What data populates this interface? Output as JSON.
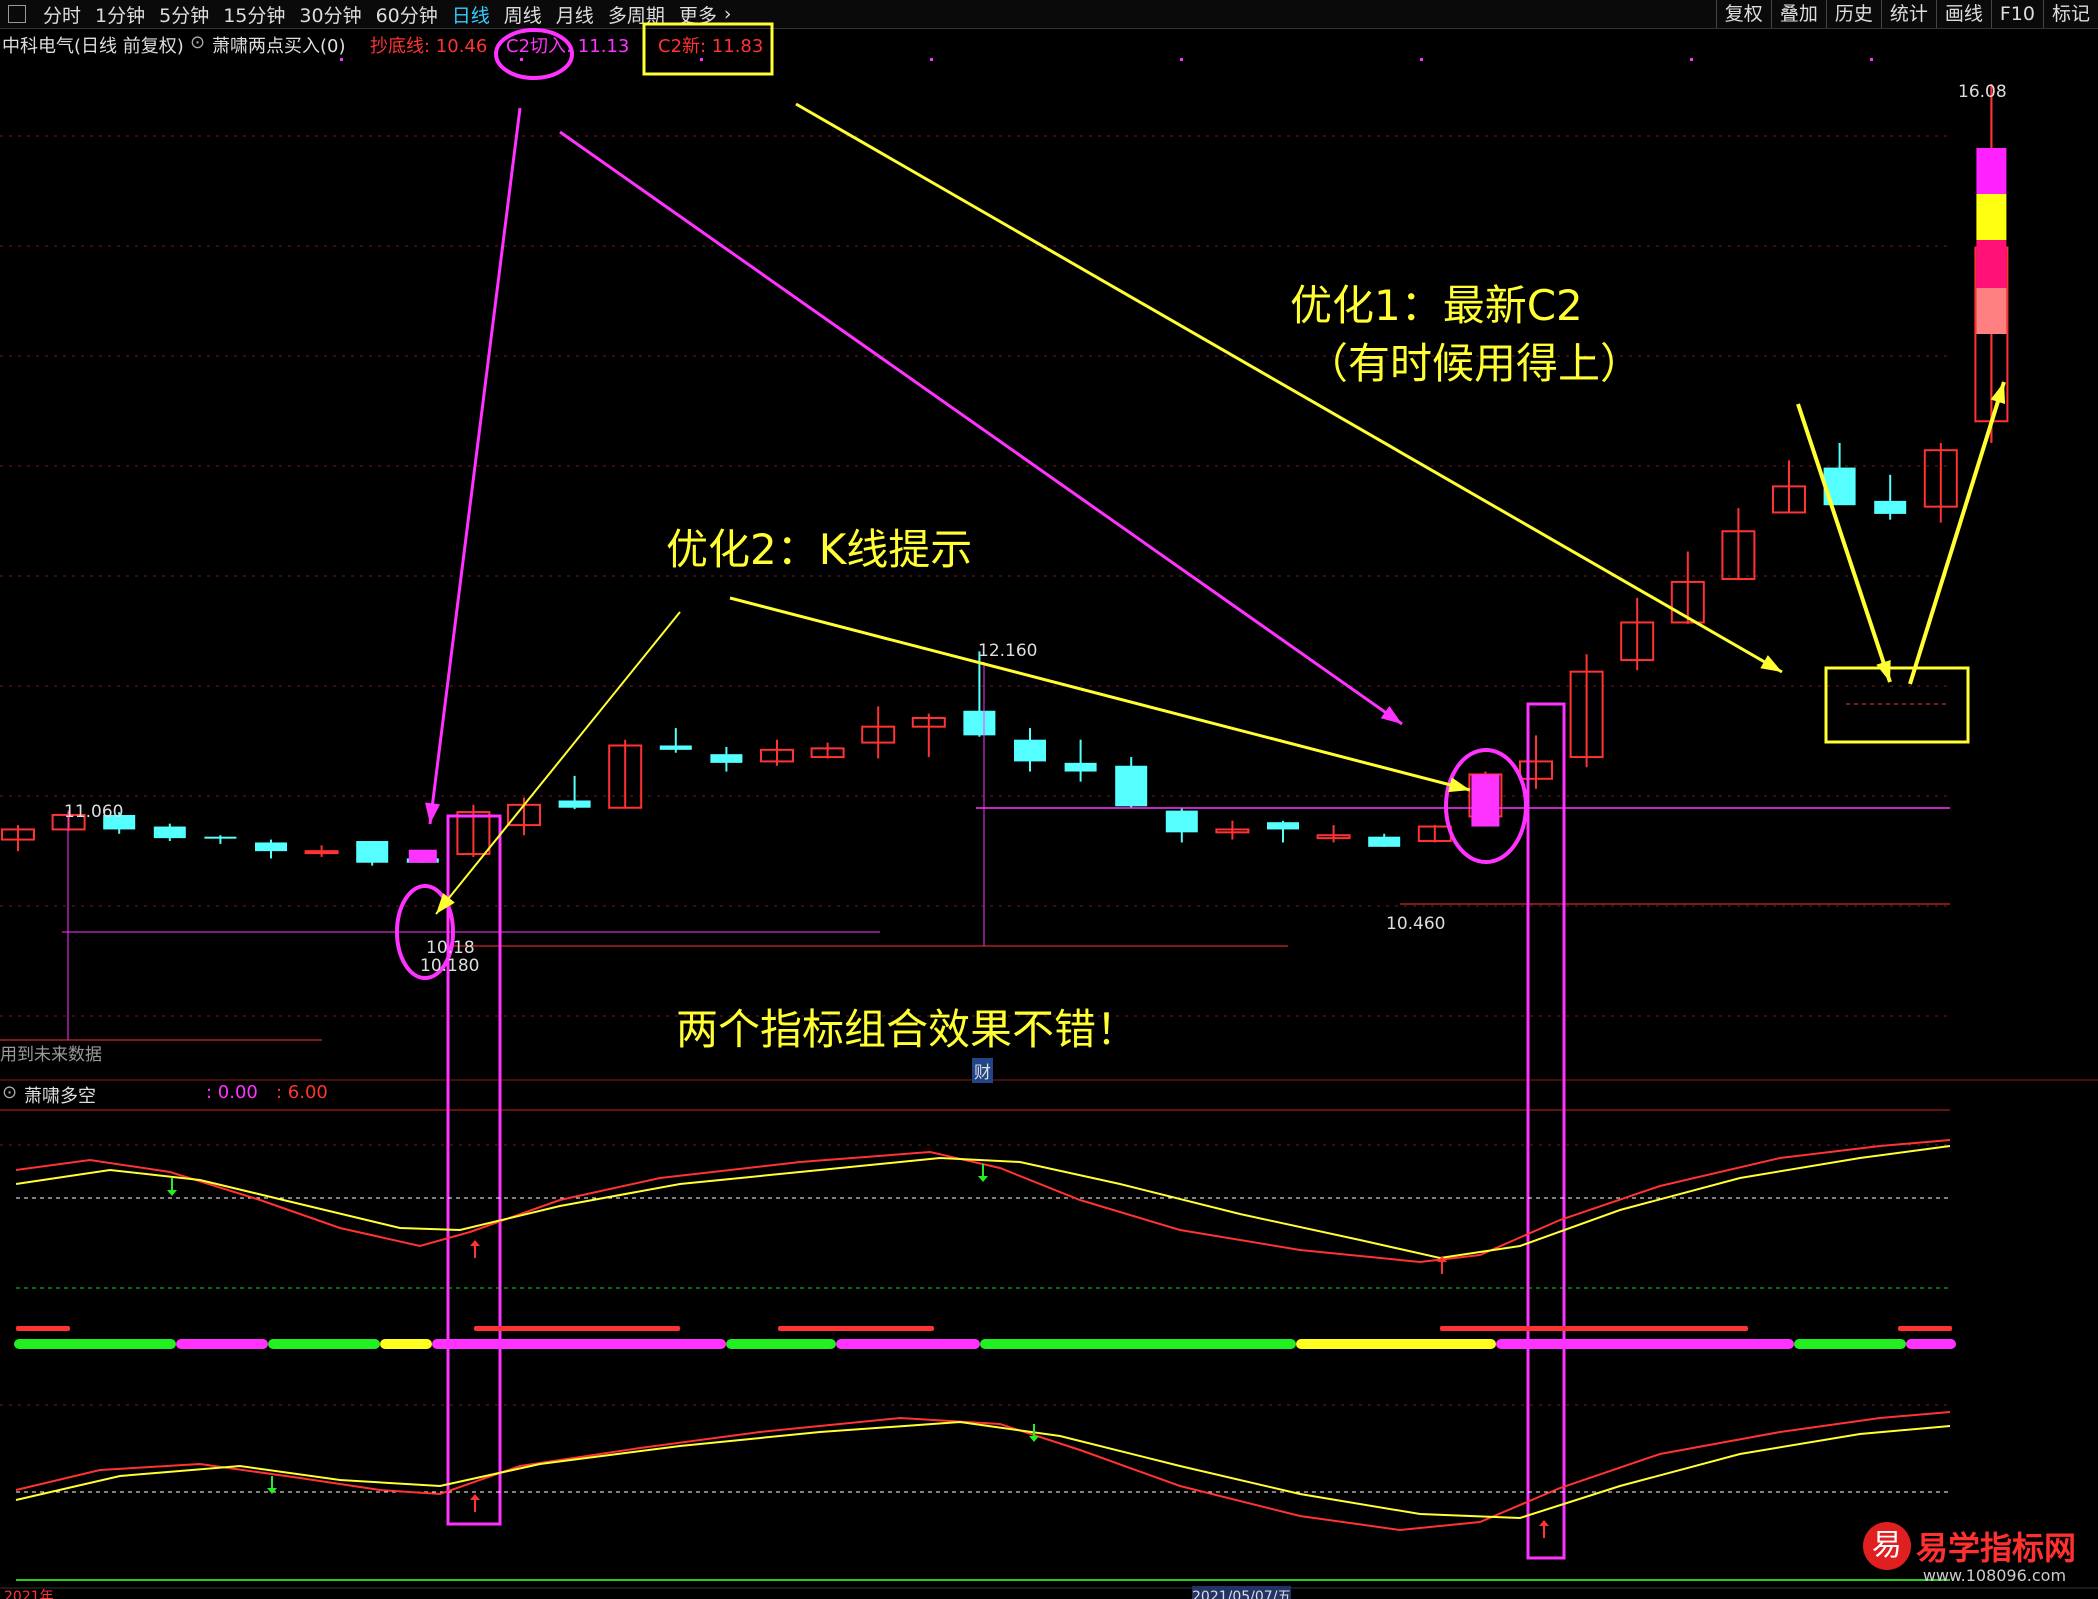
{
  "toolbar": {
    "periods": [
      "分时",
      "1分钟",
      "5分钟",
      "15分钟",
      "30分钟",
      "60分钟",
      "日线",
      "周线",
      "月线",
      "多周期",
      "更多"
    ],
    "active_period": "日线",
    "right_buttons": [
      "复权",
      "叠加",
      "历史",
      "统计",
      "画线",
      "F10",
      "标记"
    ]
  },
  "info": {
    "stock": "中科电气(日线 前复权)",
    "indicator": "萧啸两点买入(0)",
    "line1": "抄底线: 10.46",
    "line2": "C2切入: 11.13",
    "line3": "C2新: 11.83"
  },
  "price_labels": {
    "high_right": "16.08",
    "mid_high": "12.160",
    "left_high": "11.060",
    "low_mid": "10.460",
    "low_left": "10.180",
    "small_left": "10.18"
  },
  "notes": {
    "future_data": "用到未来数据",
    "cai": "财"
  },
  "annotations": {
    "opt1_line1": "优化1：最新C2",
    "opt1_line2": "（有时候用得上）",
    "opt2": "优化2：K线提示",
    "summary": "两个指标组合效果不错！"
  },
  "sub_indicator": {
    "name": "萧啸多空",
    "v1": ": 0.00",
    "v2": ": 6.00"
  },
  "bottom": {
    "date_left": "2021年",
    "date_mid": "2021/05/07/五"
  },
  "watermark": {
    "logo_char": "易",
    "title": "易学指标网",
    "url": "www.108096.com"
  },
  "colors": {
    "up": "#ff3333",
    "down": "#55ffff",
    "magenta": "#ff33ff",
    "yellow": "#ffff33",
    "grid": "#7a1a1a"
  },
  "chart_data": {
    "type": "candlestick",
    "candles": [
      {
        "o": 10.86,
        "h": 10.96,
        "l": 10.78,
        "c": 10.93
      },
      {
        "o": 10.93,
        "h": 11.06,
        "l": 10.92,
        "c": 11.03
      },
      {
        "o": 11.03,
        "h": 11.05,
        "l": 10.9,
        "c": 10.93
      },
      {
        "o": 10.95,
        "h": 10.97,
        "l": 10.85,
        "c": 10.87
      },
      {
        "o": 10.88,
        "h": 10.89,
        "l": 10.83,
        "c": 10.87
      },
      {
        "o": 10.84,
        "h": 10.86,
        "l": 10.73,
        "c": 10.78
      },
      {
        "o": 10.78,
        "h": 10.82,
        "l": 10.74,
        "c": 10.78
      },
      {
        "o": 10.85,
        "h": 10.85,
        "l": 10.68,
        "c": 10.7
      },
      {
        "o": 10.73,
        "h": 10.75,
        "l": 10.7,
        "c": 10.7
      },
      {
        "o": 10.76,
        "h": 11.1,
        "l": 10.74,
        "c": 11.05
      },
      {
        "o": 10.96,
        "h": 11.15,
        "l": 10.89,
        "c": 11.1
      },
      {
        "o": 11.13,
        "h": 11.3,
        "l": 11.07,
        "c": 11.08
      },
      {
        "o": 11.08,
        "h": 11.55,
        "l": 11.08,
        "c": 11.51
      },
      {
        "o": 11.51,
        "h": 11.63,
        "l": 11.46,
        "c": 11.48
      },
      {
        "o": 11.45,
        "h": 11.5,
        "l": 11.33,
        "c": 11.39
      },
      {
        "o": 11.4,
        "h": 11.55,
        "l": 11.37,
        "c": 11.48
      },
      {
        "o": 11.43,
        "h": 11.53,
        "l": 11.42,
        "c": 11.49
      },
      {
        "o": 11.53,
        "h": 11.78,
        "l": 11.42,
        "c": 11.64
      },
      {
        "o": 11.64,
        "h": 11.73,
        "l": 11.43,
        "c": 11.7
      },
      {
        "o": 11.75,
        "h": 12.16,
        "l": 11.57,
        "c": 11.58
      },
      {
        "o": 11.55,
        "h": 11.63,
        "l": 11.33,
        "c": 11.4
      },
      {
        "o": 11.39,
        "h": 11.55,
        "l": 11.26,
        "c": 11.33
      },
      {
        "o": 11.37,
        "h": 11.43,
        "l": 11.08,
        "c": 11.09
      },
      {
        "o": 11.06,
        "h": 11.08,
        "l": 10.84,
        "c": 10.91
      },
      {
        "o": 10.91,
        "h": 10.99,
        "l": 10.86,
        "c": 10.93
      },
      {
        "o": 10.98,
        "h": 10.99,
        "l": 10.84,
        "c": 10.93
      },
      {
        "o": 10.87,
        "h": 10.96,
        "l": 10.84,
        "c": 10.89
      },
      {
        "o": 10.88,
        "h": 10.9,
        "l": 10.81,
        "c": 10.81
      },
      {
        "o": 10.85,
        "h": 10.96,
        "l": 10.84,
        "c": 10.95
      },
      {
        "o": 11.02,
        "h": 11.33,
        "l": 10.95,
        "c": 11.31
      },
      {
        "o": 11.28,
        "h": 11.58,
        "l": 11.21,
        "c": 11.4
      },
      {
        "o": 11.43,
        "h": 12.14,
        "l": 11.36,
        "c": 12.02
      },
      {
        "o": 12.1,
        "h": 12.53,
        "l": 12.03,
        "c": 12.36
      },
      {
        "o": 12.36,
        "h": 12.85,
        "l": 12.35,
        "c": 12.64
      },
      {
        "o": 12.66,
        "h": 13.15,
        "l": 12.66,
        "c": 12.99
      },
      {
        "o": 13.12,
        "h": 13.48,
        "l": 13.12,
        "c": 13.3
      },
      {
        "o": 13.43,
        "h": 13.6,
        "l": 13.18,
        "c": 13.17
      },
      {
        "o": 13.2,
        "h": 13.38,
        "l": 13.07,
        "c": 13.11
      },
      {
        "o": 13.16,
        "h": 13.6,
        "l": 13.05,
        "c": 13.55
      },
      {
        "o": 13.75,
        "h": 16.08,
        "l": 13.6,
        "c": 14.95
      }
    ]
  }
}
